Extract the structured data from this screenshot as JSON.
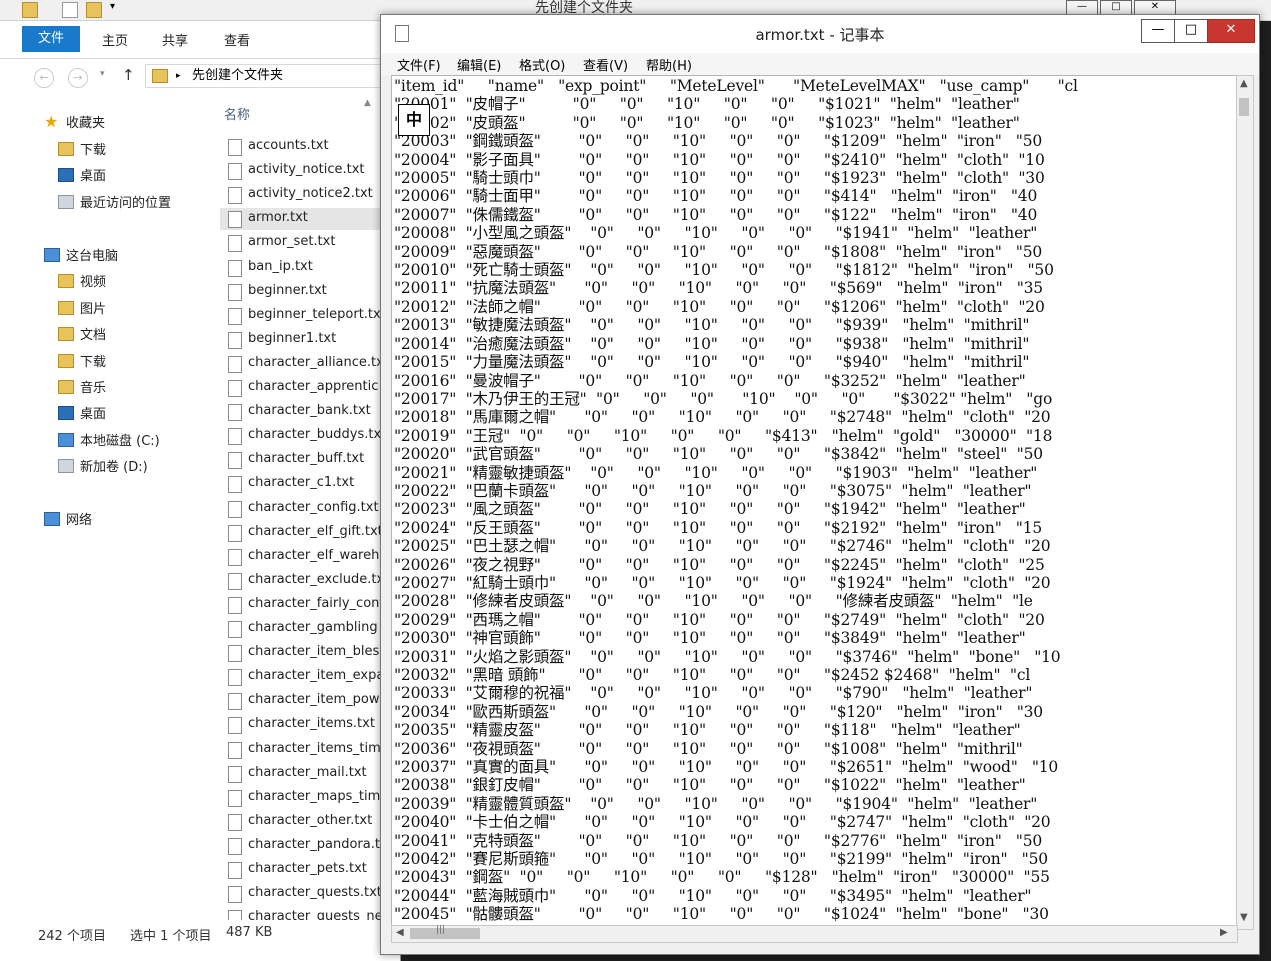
{
  "explorer": {
    "title": "先创建个文件夹",
    "title_controls": [
      "—",
      "□",
      "✕"
    ],
    "ribbon_tabs": [
      "文件",
      "主页",
      "共享",
      "查看"
    ],
    "nav_back": "←",
    "nav_forward": "→",
    "nav_up": "↑",
    "breadcrumb": "先创建个文件夹",
    "nav_pane": [
      {
        "label": "收藏夹",
        "icon": "star-icon"
      },
      {
        "label": "下载",
        "icon": "download-folder-icon"
      },
      {
        "label": "桌面",
        "icon": "desktop-icon"
      },
      {
        "label": "最近访问的位置",
        "icon": "recent-places-icon"
      },
      {
        "label": "这台电脑",
        "icon": "computer-icon"
      },
      {
        "label": "视频",
        "icon": "videos-folder-icon"
      },
      {
        "label": "图片",
        "icon": "pictures-folder-icon"
      },
      {
        "label": "文档",
        "icon": "documents-folder-icon"
      },
      {
        "label": "下载",
        "icon": "download-folder-icon"
      },
      {
        "label": "音乐",
        "icon": "music-folder-icon"
      },
      {
        "label": "桌面",
        "icon": "desktop-icon"
      },
      {
        "label": "本地磁盘 (C:)",
        "icon": "local-disk-icon"
      },
      {
        "label": "新加卷 (D:)",
        "icon": "drive-icon"
      },
      {
        "label": "网络",
        "icon": "network-icon"
      }
    ],
    "column_header": "名称",
    "files": [
      "accounts.txt",
      "activity_notice.txt",
      "activity_notice2.txt",
      "armor.txt",
      "armor_set.txt",
      "ban_ip.txt",
      "beginner.txt",
      "beginner_teleport.tx",
      "beginner1.txt",
      "character_alliance.tx",
      "character_apprentic",
      "character_bank.txt",
      "character_buddys.tx",
      "character_buff.txt",
      "character_c1.txt",
      "character_config.txt",
      "character_elf_gift.txt",
      "character_elf_wareh",
      "character_exclude.tx",
      "character_fairly_conf",
      "character_gambling",
      "character_item_bless",
      "character_item_expa",
      "character_item_pow",
      "character_items.txt",
      "character_items_tim",
      "character_mail.txt",
      "character_maps_tim",
      "character_other.txt",
      "character_pandora.t",
      "character_pets.txt",
      "character_quests.txt",
      "character_quests_ne"
    ],
    "selected_file": "armor.txt",
    "status": {
      "count": "242 个项目",
      "selection": "选中 1 个项目",
      "size": "487 KB"
    }
  },
  "notepad": {
    "title": "armor.txt - 记事本",
    "title_controls": [
      "—",
      "□",
      "✕"
    ],
    "menus": [
      "文件(F)",
      "编辑(E)",
      "格式(O)",
      "查看(V)",
      "帮助(H)"
    ],
    "ime_indicator": "中",
    "lines": [
      "\"item_id\"     \"name\"   \"exp_point\"     \"MeteLevel\"      \"MeteLevelMAX\"   \"use_camp\"      \"cl",
      "\"20001\"  \"皮帽子\"          \"0\"     \"0\"     \"10\"     \"0\"     \"0\"     \"$1021\"  \"helm\"  \"leather\"",
      "\"20002\"  \"皮頭盔\"          \"0\"     \"0\"     \"10\"     \"0\"     \"0\"     \"$1023\"  \"helm\"  \"leather\"",
      "\"20003\"  \"鋼鐵頭盔\"        \"0\"     \"0\"     \"10\"     \"0\"     \"0\"     \"$1209\"  \"helm\"  \"iron\"   \"50",
      "\"20004\"  \"影子面具\"        \"0\"     \"0\"     \"10\"     \"0\"     \"0\"     \"$2410\"  \"helm\"  \"cloth\"  \"10",
      "\"20005\"  \"騎士頭巾\"        \"0\"     \"0\"     \"10\"     \"0\"     \"0\"     \"$1923\"  \"helm\"  \"cloth\"  \"30",
      "\"20006\"  \"騎士面甲\"        \"0\"     \"0\"     \"10\"     \"0\"     \"0\"     \"$414\"   \"helm\"  \"iron\"   \"40",
      "\"20007\"  \"侏儒鐵盔\"        \"0\"     \"0\"     \"10\"     \"0\"     \"0\"     \"$122\"   \"helm\"  \"iron\"   \"40",
      "\"20008\"  \"小型風之頭盔\"    \"0\"     \"0\"     \"10\"     \"0\"     \"0\"     \"$1941\"  \"helm\"  \"leather\"",
      "\"20009\"  \"惡魔頭盔\"        \"0\"     \"0\"     \"10\"     \"0\"     \"0\"     \"$1808\"  \"helm\"  \"iron\"   \"50",
      "\"20010\"  \"死亡騎士頭盔\"    \"0\"     \"0\"     \"10\"     \"0\"     \"0\"     \"$1812\"  \"helm\"  \"iron\"   \"50",
      "\"20011\"  \"抗魔法頭盔\"      \"0\"     \"0\"     \"10\"     \"0\"     \"0\"     \"$569\"   \"helm\"  \"iron\"   \"35",
      "\"20012\"  \"法師之帽\"        \"0\"     \"0\"     \"10\"     \"0\"     \"0\"     \"$1206\"  \"helm\"  \"cloth\"  \"20",
      "\"20013\"  \"敏捷魔法頭盔\"    \"0\"     \"0\"     \"10\"     \"0\"     \"0\"     \"$939\"   \"helm\"  \"mithril\"",
      "\"20014\"  \"治癒魔法頭盔\"    \"0\"     \"0\"     \"10\"     \"0\"     \"0\"     \"$938\"   \"helm\"  \"mithril\"",
      "\"20015\"  \"力量魔法頭盔\"    \"0\"     \"0\"     \"10\"     \"0\"     \"0\"     \"$940\"   \"helm\"  \"mithril\"",
      "\"20016\"  \"曼波帽子\"        \"0\"     \"0\"     \"10\"     \"0\"     \"0\"     \"$3252\"  \"helm\"  \"leather\"",
      "\"20017\"  \"木乃伊王的王冠\"  \"0\"     \"0\"     \"0\"      \"10\"    \"0\"     \"0\"      \"$3022\" \"helm\"   \"go",
      "\"20018\"  \"馬庫爾之帽\"      \"0\"     \"0\"     \"10\"     \"0\"     \"0\"     \"$2748\"  \"helm\"  \"cloth\"  \"20",
      "\"20019\"  \"王冠\"  \"0\"     \"0\"     \"10\"     \"0\"     \"0\"     \"$413\"   \"helm\"  \"gold\"   \"30000\"  \"18",
      "\"20020\"  \"武官頭盔\"        \"0\"     \"0\"     \"10\"     \"0\"     \"0\"     \"$3842\"  \"helm\"  \"steel\"  \"50",
      "\"20021\"  \"精靈敏捷頭盔\"    \"0\"     \"0\"     \"10\"     \"0\"     \"0\"     \"$1903\"  \"helm\"  \"leather\"",
      "\"20022\"  \"巴蘭卡頭盔\"      \"0\"     \"0\"     \"10\"     \"0\"     \"0\"     \"$3075\"  \"helm\"  \"leather\"",
      "\"20023\"  \"風之頭盔\"        \"0\"     \"0\"     \"10\"     \"0\"     \"0\"     \"$1942\"  \"helm\"  \"leather\"",
      "\"20024\"  \"反王頭盔\"        \"0\"     \"0\"     \"10\"     \"0\"     \"0\"     \"$2192\"  \"helm\"  \"iron\"   \"15",
      "\"20025\"  \"巴土瑟之帽\"      \"0\"     \"0\"     \"10\"     \"0\"     \"0\"     \"$2746\"  \"helm\"  \"cloth\"  \"20",
      "\"20026\"  \"夜之視野\"        \"0\"     \"0\"     \"10\"     \"0\"     \"0\"     \"$2245\"  \"helm\"  \"cloth\"  \"25",
      "\"20027\"  \"紅騎士頭巾\"      \"0\"     \"0\"     \"10\"     \"0\"     \"0\"     \"$1924\"  \"helm\"  \"cloth\"  \"20",
      "\"20028\"  \"修練者皮頭盔\"    \"0\"     \"0\"     \"10\"     \"0\"     \"0\"     \"修練者皮頭盔\"  \"helm\"  \"le",
      "\"20029\"  \"西瑪之帽\"        \"0\"     \"0\"     \"10\"     \"0\"     \"0\"     \"$2749\"  \"helm\"  \"cloth\"  \"20",
      "\"20030\"  \"神官頭飾\"        \"0\"     \"0\"     \"10\"     \"0\"     \"0\"     \"$3849\"  \"helm\"  \"leather\"",
      "\"20031\"  \"火焰之影頭盔\"    \"0\"     \"0\"     \"10\"     \"0\"     \"0\"     \"$3746\"  \"helm\"  \"bone\"   \"10",
      "\"20032\"  \"黑暗 頭飾\"       \"0\"     \"0\"     \"10\"     \"0\"     \"0\"     \"$2452 $2468\"  \"helm\"  \"cl",
      "\"20033\"  \"艾爾穆的祝福\"    \"0\"     \"0\"     \"10\"     \"0\"     \"0\"     \"$790\"   \"helm\"  \"leather\"",
      "\"20034\"  \"歐西斯頭盔\"      \"0\"     \"0\"     \"10\"     \"0\"     \"0\"     \"$120\"   \"helm\"  \"iron\"   \"30",
      "\"20035\"  \"精靈皮盔\"        \"0\"     \"0\"     \"10\"     \"0\"     \"0\"     \"$118\"   \"helm\"  \"leather\"",
      "\"20036\"  \"夜視頭盔\"        \"0\"     \"0\"     \"10\"     \"0\"     \"0\"     \"$1008\"  \"helm\"  \"mithril\"",
      "\"20037\"  \"真實的面具\"      \"0\"     \"0\"     \"10\"     \"0\"     \"0\"     \"$2651\"  \"helm\"  \"wood\"   \"10",
      "\"20038\"  \"銀釘皮帽\"        \"0\"     \"0\"     \"10\"     \"0\"     \"0\"     \"$1022\"  \"helm\"  \"leather\"",
      "\"20039\"  \"精靈體質頭盔\"    \"0\"     \"0\"     \"10\"     \"0\"     \"0\"     \"$1904\"  \"helm\"  \"leather\"",
      "\"20040\"  \"卡士伯之帽\"      \"0\"     \"0\"     \"10\"     \"0\"     \"0\"     \"$2747\"  \"helm\"  \"cloth\"  \"20",
      "\"20041\"  \"克特頭盔\"        \"0\"     \"0\"     \"10\"     \"0\"     \"0\"     \"$2776\"  \"helm\"  \"iron\"   \"50",
      "\"20042\"  \"賽尼斯頭箍\"      \"0\"     \"0\"     \"10\"     \"0\"     \"0\"     \"$2199\"  \"helm\"  \"iron\"   \"50",
      "\"20043\"  \"鋼盔\"  \"0\"     \"0\"     \"10\"     \"0\"     \"0\"     \"$128\"   \"helm\"  \"iron\"   \"30000\"  \"55",
      "\"20044\"  \"藍海賊頭巾\"      \"0\"     \"0\"     \"10\"     \"0\"     \"0\"     \"$3495\"  \"helm\"  \"leather\"",
      "\"20045\"  \"骷髏頭盔\"        \"0\"     \"0\"     \"10\"     \"0\"     \"0\"     \"$1024\"  \"helm\"  \"bone\"   \"30"
    ],
    "scroll_thumb_h": "|||"
  },
  "colors": {
    "ribbon_file_tab": "#1979ca",
    "close_button": "#c7372f"
  }
}
